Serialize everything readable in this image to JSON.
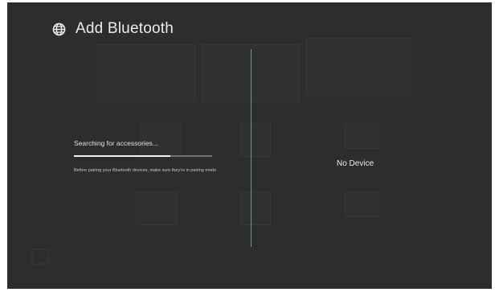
{
  "header": {
    "icon": "globe-icon",
    "title": "Add Bluetooth"
  },
  "search": {
    "status": "Searching for accessories...",
    "progress_fraction": 0.7,
    "hint": "Before pairing your Bluetooth devices, make sure they're in pairing mode"
  },
  "devices": {
    "empty_label": "No Device"
  },
  "colors": {
    "background": "#2b2d2e",
    "divider": "#7b8e97",
    "progress_fill": "#f2f2f2",
    "progress_track": "#6e7375"
  }
}
